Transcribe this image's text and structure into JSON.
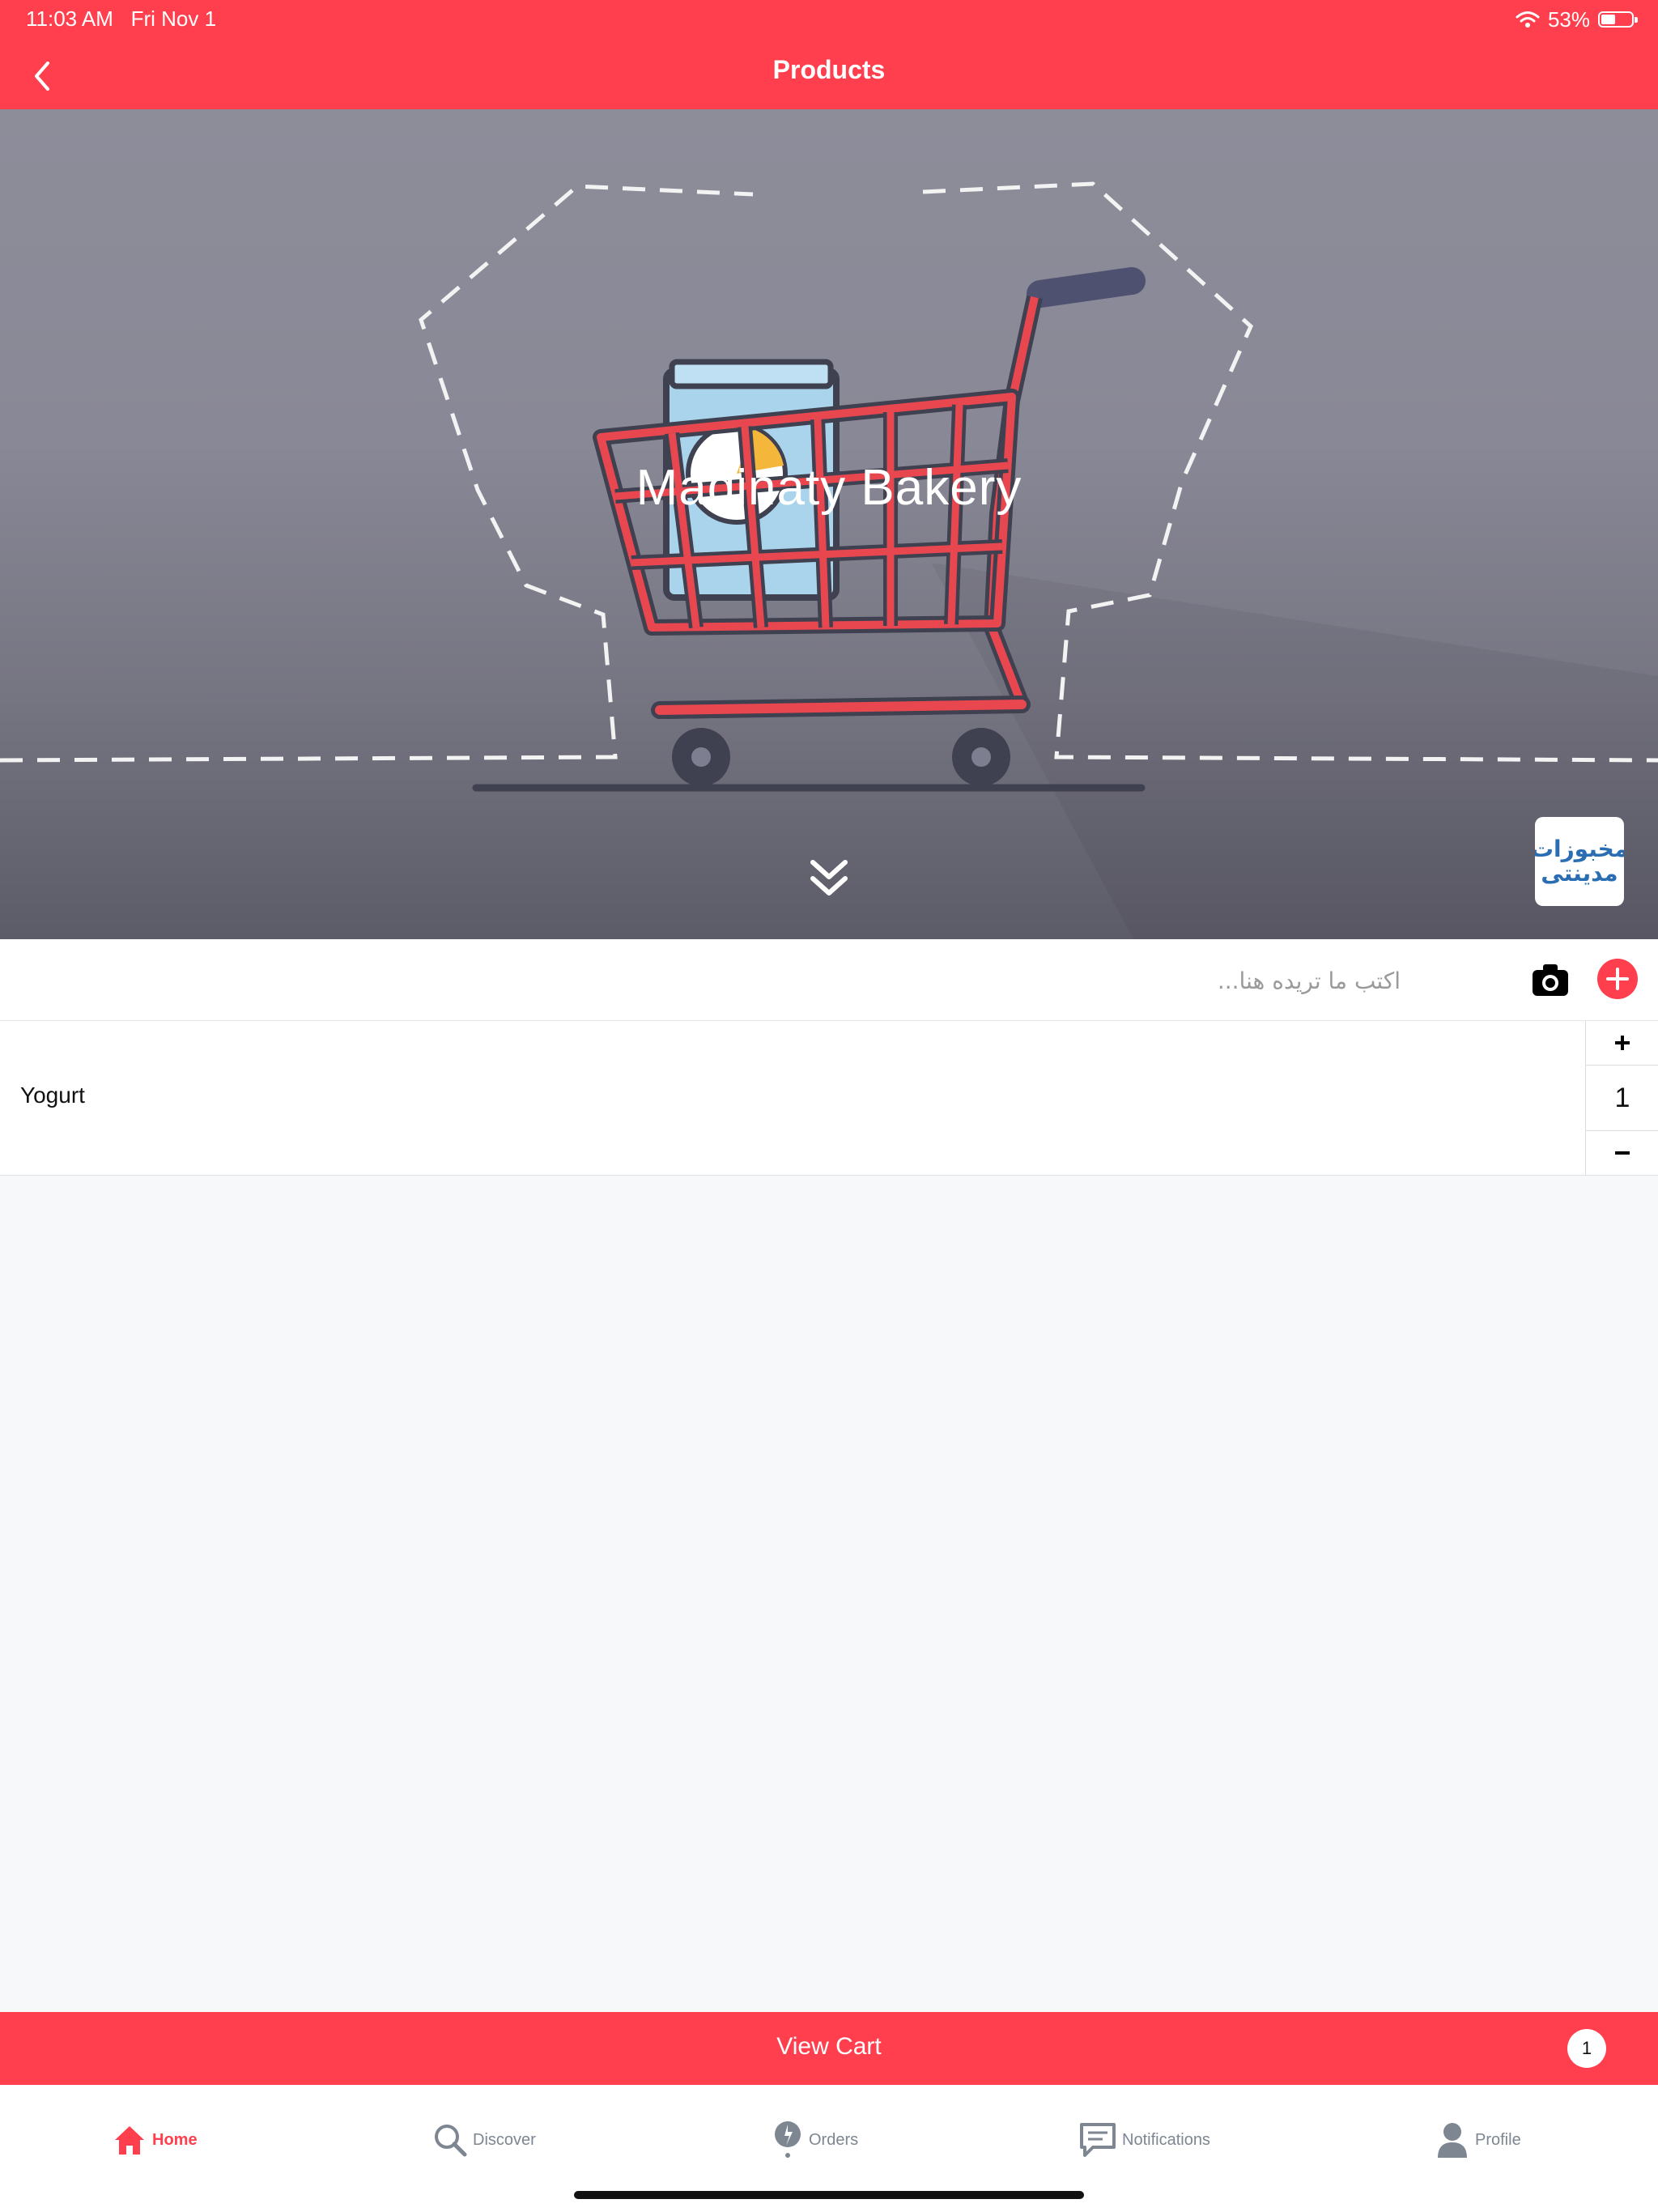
{
  "status_bar": {
    "time": "11:03 AM",
    "date": "Fri Nov 1",
    "battery": "53%",
    "battery_level": 0.53,
    "icons": [
      "wifi-icon",
      "battery-icon"
    ]
  },
  "nav": {
    "title": "Products",
    "back_icon": "chevron-left-icon"
  },
  "hero": {
    "store_name": "Madinaty Bakery",
    "logo_text_line1": "مخبوزات",
    "logo_text_line2": "مدينتى",
    "scroll_icon": "double-chevron-down-icon"
  },
  "search": {
    "placeholder": "اكتب ما تريده هنا...",
    "value": ""
  },
  "items": [
    {
      "name": "Yogurt",
      "quantity": "1"
    }
  ],
  "cart": {
    "label": "View Cart",
    "count": "1"
  },
  "tabs": [
    {
      "label": "Home",
      "icon": "home-icon",
      "active": true
    },
    {
      "label": "Discover",
      "icon": "search-icon",
      "active": false
    },
    {
      "label": "Orders",
      "icon": "orders-icon",
      "active": false
    },
    {
      "label": "Notifications",
      "icon": "chat-icon",
      "active": false
    },
    {
      "label": "Profile",
      "icon": "person-icon",
      "active": false
    }
  ],
  "colors": {
    "accent": "#ff3f4d",
    "inactive_tab": "#7d8691",
    "background": "#f7f8fa"
  }
}
